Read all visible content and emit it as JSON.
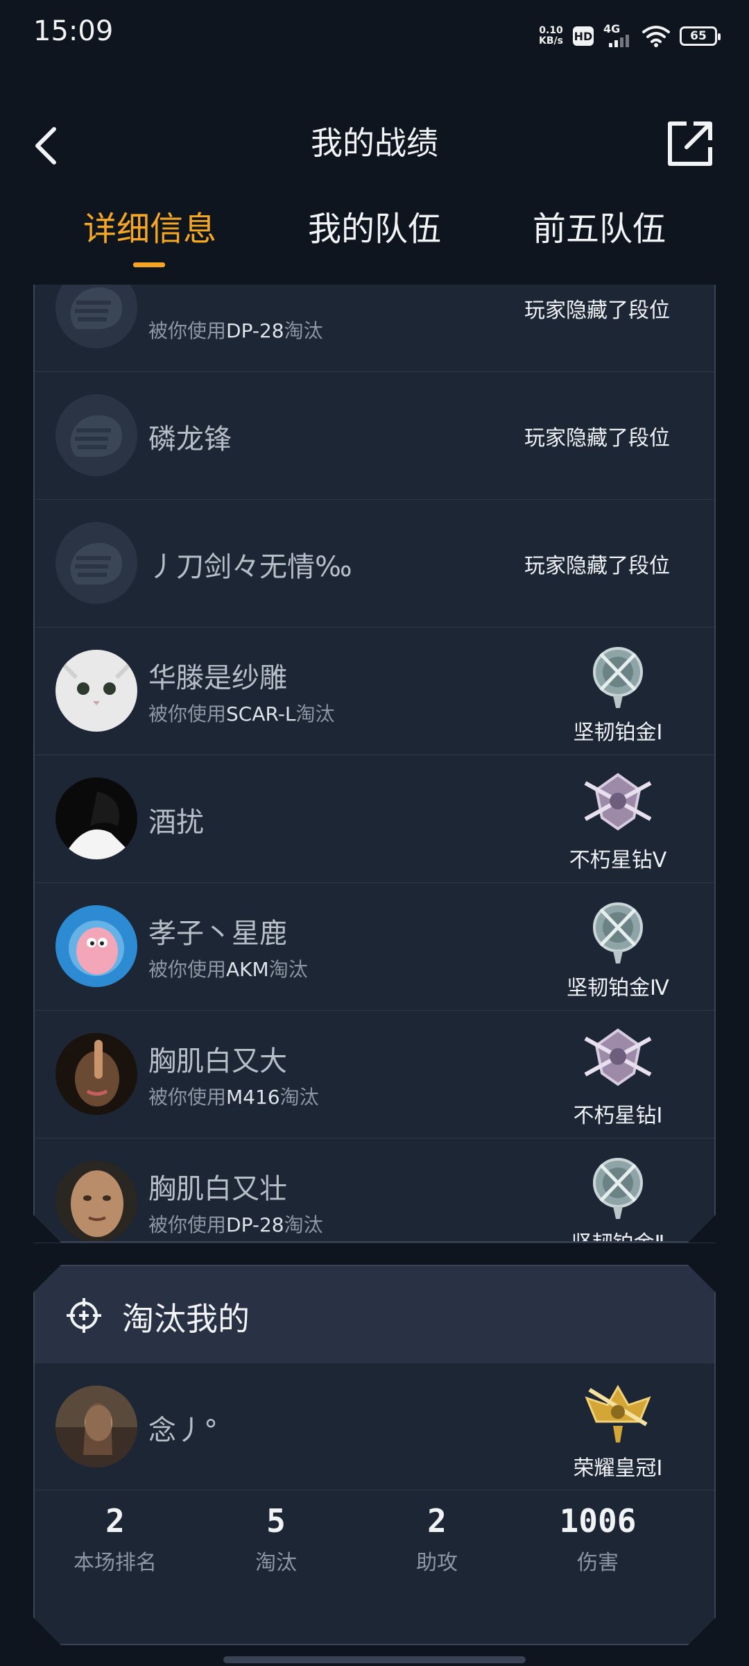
{
  "status_bar": {
    "time": "15:09",
    "net_speed_value": "0.10",
    "net_speed_unit": "KB/s",
    "hd": "HD",
    "network": "4G",
    "battery": "65"
  },
  "header": {
    "title": "我的战绩",
    "back_icon": "chevron-left-icon",
    "share_icon": "share-icon"
  },
  "tabs": [
    {
      "label": "详细信息",
      "active": true
    },
    {
      "label": "我的队伍",
      "active": false
    },
    {
      "label": "前五队伍",
      "active": false
    }
  ],
  "kills": [
    {
      "name": "",
      "weapon_prefix": "被你使用",
      "weapon": "DP-28",
      "weapon_suffix": "淘汰",
      "rank": "玩家隐藏了段位"
    },
    {
      "name": "磷龙锋",
      "rank": "玩家隐藏了段位"
    },
    {
      "name": "丿刀剑々无情‰",
      "rank": "玩家隐藏了段位"
    },
    {
      "name": "华滕是纱雕",
      "weapon_prefix": "被你使用",
      "weapon": "SCAR-L",
      "weapon_suffix": "淘汰",
      "rank": "坚韧铂金Ⅰ",
      "emblem": "platinum-emblem-icon"
    },
    {
      "name": "酒扰",
      "rank": "不朽星钻Ⅴ",
      "emblem": "diamond-emblem-icon"
    },
    {
      "name": "孝子丶星鹿",
      "weapon_prefix": "被你使用",
      "weapon": "AKM",
      "weapon_suffix": "淘汰",
      "rank": "坚韧铂金Ⅳ",
      "emblem": "platinum-emblem-icon"
    },
    {
      "name": "胸肌白又大",
      "weapon_prefix": "被你使用",
      "weapon": "M416",
      "weapon_suffix": "淘汰",
      "rank": "不朽星钻Ⅰ",
      "emblem": "diamond-emblem-icon"
    },
    {
      "name": "胸肌白又壮",
      "weapon_prefix": "被你使用",
      "weapon": "DP-28",
      "weapon_suffix": "淘汰",
      "rank": "坚韧铂金Ⅱ",
      "emblem": "platinum-emblem-icon"
    }
  ],
  "killed_me": {
    "title": "淘汰我的",
    "name": "念丿°",
    "rank": "荣耀皇冠Ⅰ",
    "emblem": "crown-emblem-icon",
    "stats": [
      {
        "value": "2",
        "label": "本场排名"
      },
      {
        "value": "5",
        "label": "淘汰"
      },
      {
        "value": "2",
        "label": "助攻"
      },
      {
        "value": "1006",
        "label": "伤害"
      }
    ]
  },
  "colors": {
    "accent": "#f5a623",
    "background": "#0f151f",
    "panel": "#1d2634"
  }
}
